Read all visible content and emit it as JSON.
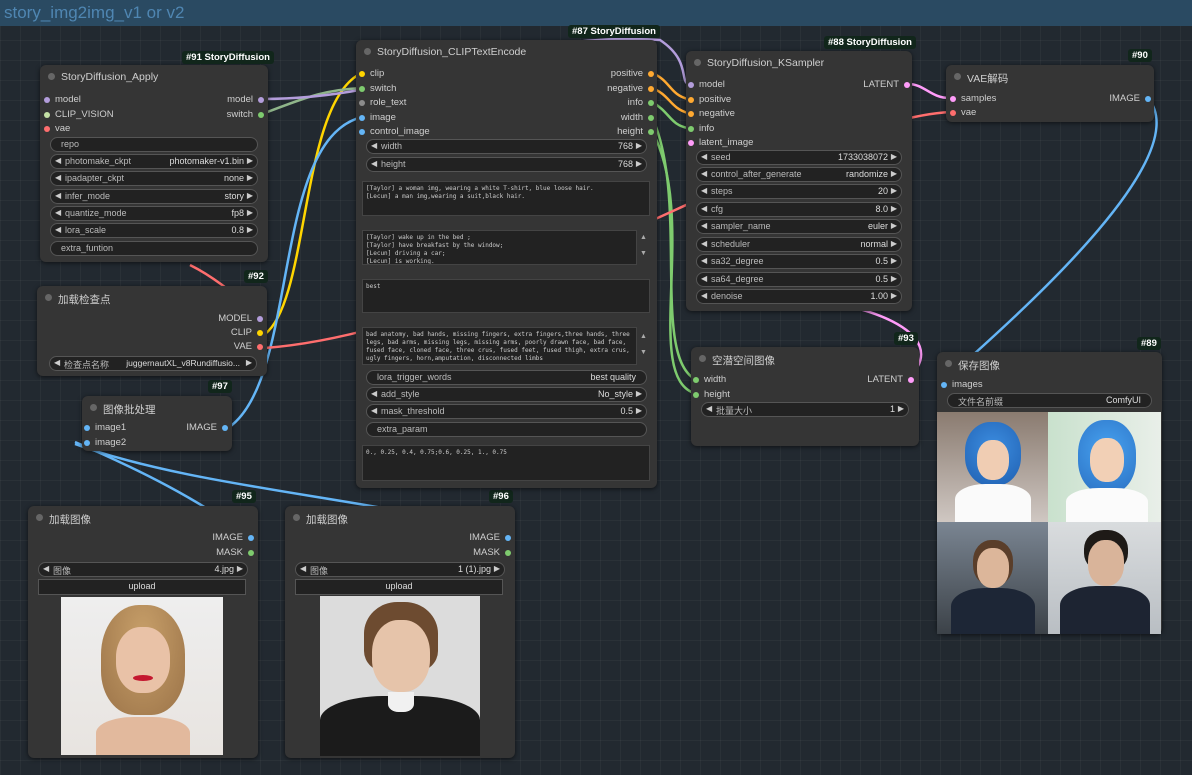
{
  "window": {
    "title": "story_img2img_v1 or v2"
  },
  "colors": {
    "clip": "#ffd500",
    "model": "#b39ddb",
    "vae": "#ff6e6e",
    "image": "#64b5f6",
    "latent": "#ff9cf9",
    "conditioning": "#ffa931",
    "int": "#7ecb6e",
    "string": "#8c8c8c"
  },
  "nodes": {
    "apply": {
      "badge": "#91 StoryDiffusion",
      "title": "StoryDiffusion_Apply",
      "inputs": [
        "model",
        "CLIP_VISION",
        "vae"
      ],
      "outputs": [
        "model",
        "switch"
      ],
      "widgets": [
        {
          "label": "repo",
          "value": ""
        },
        {
          "label": "photomake_ckpt",
          "value": "photomaker-v1.bin"
        },
        {
          "label": "ipadapter_ckpt",
          "value": "none"
        },
        {
          "label": "infer_mode",
          "value": "story"
        },
        {
          "label": "quantize_mode",
          "value": "fp8"
        },
        {
          "label": "lora_scale",
          "value": "0.8"
        },
        {
          "label": "extra_funtion",
          "value": ""
        }
      ]
    },
    "checkpoint": {
      "badge": "#92",
      "title": "加载检查点",
      "outputs": [
        "MODEL",
        "CLIP",
        "VAE"
      ],
      "widget": {
        "label": "检查点名称",
        "value": "juggernautXL_v8Rundiffusio..."
      }
    },
    "batch": {
      "badge": "#97",
      "title": "图像批处理",
      "inputs": [
        "image1",
        "image2"
      ],
      "outputs": [
        "IMAGE"
      ]
    },
    "load95": {
      "badge": "#95",
      "title": "加载图像",
      "outputs": [
        "IMAGE",
        "MASK"
      ],
      "widget": {
        "label": "图像",
        "value": "4.jpg"
      },
      "button": "upload"
    },
    "load96": {
      "badge": "#96",
      "title": "加载图像",
      "outputs": [
        "IMAGE",
        "MASK"
      ],
      "widget": {
        "label": "图像",
        "value": "1 (1).jpg"
      },
      "button": "upload"
    },
    "encode": {
      "badge": "#87 StoryDiffusion",
      "title": "StoryDiffusion_CLIPTextEncode",
      "inputs": [
        "clip",
        "switch",
        "role_text",
        "image",
        "control_image"
      ],
      "outputs": [
        "positive",
        "negative",
        "info",
        "width",
        "height"
      ],
      "width": {
        "label": "width",
        "value": "768"
      },
      "height": {
        "label": "height",
        "value": "768"
      },
      "role_text": "[Taylor] a woman img, wearing a white T-shirt, blue loose hair.\n[Lecun] a man img,wearing a suit,black hair.",
      "scene_text": "[Taylor] wake up in the bed ;\n[Taylor] have breakfast by the window;\n[Lecun] driving a car;\n[Lecun] is working.",
      "pos_text": "best",
      "neg_text": "bad anatomy, bad hands, missing fingers, extra fingers,three hands, three legs, bad arms, missing legs, missing arms, poorly drawn face, bad face, fused face, cloned face, three crus, fused feet, fused thigh, extra crus, ugly fingers, horn,amputation, disconnected limbs",
      "lora_trigger": {
        "label": "lora_trigger_words",
        "value": "best quality"
      },
      "add_style": {
        "label": "add_style",
        "value": "No_style"
      },
      "mask_threshold": {
        "label": "mask_threshold",
        "value": "0.5"
      },
      "extra_param": {
        "label": "extra_param",
        "value": ""
      },
      "bottom_text": "0., 0.25, 0.4, 0.75;0.6, 0.25, 1., 0.75"
    },
    "ksampler": {
      "badge": "#88 StoryDiffusion",
      "title": "StoryDiffusion_KSampler",
      "inputs": [
        "model",
        "positive",
        "negative",
        "info",
        "latent_image"
      ],
      "outputs": [
        "LATENT"
      ],
      "widgets": [
        {
          "label": "seed",
          "value": "1733038072"
        },
        {
          "label": "control_after_generate",
          "value": "randomize"
        },
        {
          "label": "steps",
          "value": "20"
        },
        {
          "label": "cfg",
          "value": "8.0"
        },
        {
          "label": "sampler_name",
          "value": "euler"
        },
        {
          "label": "scheduler",
          "value": "normal"
        },
        {
          "label": "sa32_degree",
          "value": "0.5"
        },
        {
          "label": "sa64_degree",
          "value": "0.5"
        },
        {
          "label": "denoise",
          "value": "1.00"
        }
      ]
    },
    "vae": {
      "badge": "#90",
      "title": "VAE解码",
      "inputs": [
        "samples",
        "vae"
      ],
      "outputs": [
        "IMAGE"
      ]
    },
    "latent": {
      "badge": "#93",
      "title": "空潜空间图像",
      "inputs": [
        "width",
        "height"
      ],
      "outputs": [
        "LATENT"
      ],
      "widget": {
        "label": "批量大小",
        "value": "1"
      }
    },
    "save": {
      "badge": "#89",
      "title": "保存图像",
      "inputs": [
        "images"
      ],
      "widget": {
        "label": "文件名前缀",
        "value": "ComfyUI"
      }
    }
  }
}
